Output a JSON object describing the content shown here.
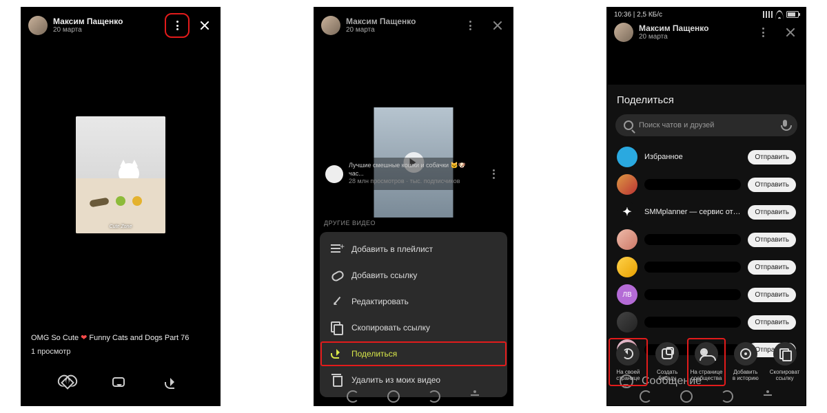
{
  "author": {
    "name": "Максим Пащенко",
    "date": "20 марта"
  },
  "screen1": {
    "thumb_caption": "Cute Zone",
    "caption_pre": "OMG So Cute ",
    "caption_heart": "❤",
    "caption_post": " Funny Cats and Dogs Part 76",
    "views": "1 просмотр"
  },
  "screen2": {
    "rec_title": "Лучшие смешные кошки и собачки 🐱🐶 час...",
    "rec_sub": "28 млн просмотров · тыс. подписчиков",
    "other_label": "ДРУГИЕ ВИДЕО",
    "menu": {
      "playlist": "Добавить в плейлист",
      "link": "Добавить ссылку",
      "edit": "Редактировать",
      "copy": "Скопировать ссылку",
      "share": "Поделиться",
      "delete": "Удалить из моих видео"
    }
  },
  "screen3": {
    "status_left": "10:36 | 2,5 КБ/с",
    "title": "Поделиться",
    "search_placeholder": "Поиск чатов и друзей",
    "send": "Отправить",
    "contacts": {
      "fav": "Избранное",
      "smm": "SMMplanner — сервис отло...",
      "lv": "ЛВ"
    },
    "message": "Сообщение",
    "actions": {
      "own": "На своей\nстранице",
      "chat": "Создать\nбеседу",
      "group": "На странице\nсообщества",
      "story": "Добавить\nв историю",
      "copy": "Скопироват\nссылку"
    }
  }
}
